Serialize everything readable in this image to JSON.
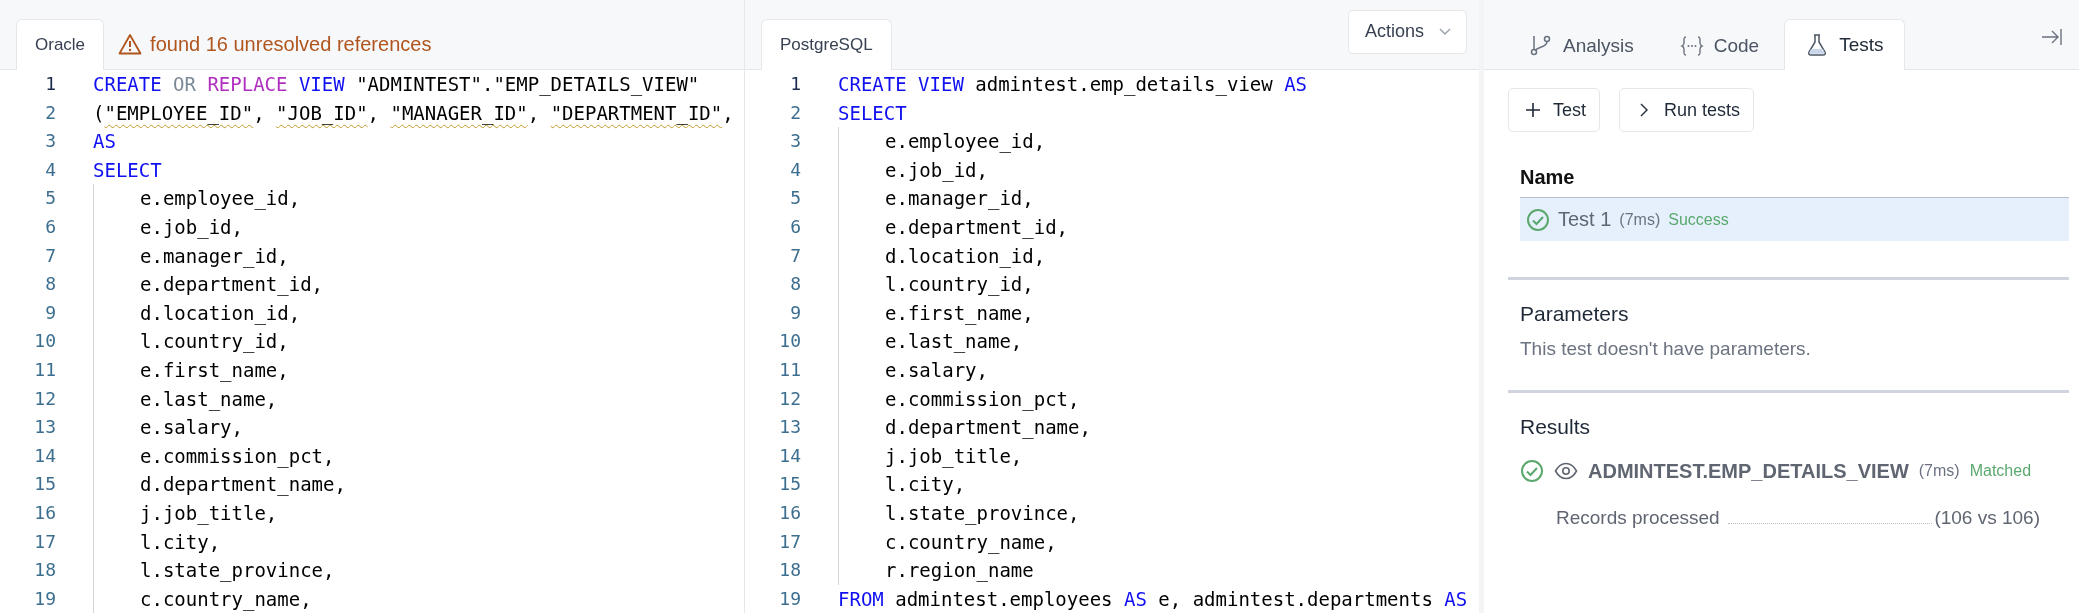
{
  "oracle_pane": {
    "tabs": [
      {
        "label": "Oracle",
        "selected": true
      }
    ],
    "warning": "found 16 unresolved references",
    "editor": {
      "lines": [
        {
          "n": "1",
          "active": true,
          "indent": false,
          "tokens": [
            {
              "text": "CREATE ",
              "kind": "keyword"
            },
            {
              "text": "OR ",
              "kind": "muted"
            },
            {
              "text": "REPLACE ",
              "kind": "special"
            },
            {
              "text": "VIEW ",
              "kind": "keyword"
            },
            {
              "text": "\"ADMINTEST\".\"EMP_DETAILS_VIEW\"",
              "kind": "plain"
            }
          ]
        },
        {
          "n": "2",
          "active": false,
          "indent": false,
          "tokens": [
            {
              "text": "(",
              "kind": "plain"
            },
            {
              "text": "\"EMPLOYEE_ID\"",
              "kind": "warn"
            },
            {
              "text": ", ",
              "kind": "plain"
            },
            {
              "text": "\"JOB_ID\"",
              "kind": "warn"
            },
            {
              "text": ", ",
              "kind": "plain"
            },
            {
              "text": "\"MANAGER_ID\"",
              "kind": "warn"
            },
            {
              "text": ", ",
              "kind": "plain"
            },
            {
              "text": "\"DEPARTMENT_ID\"",
              "kind": "warn"
            },
            {
              "text": ",",
              "kind": "plain"
            }
          ]
        },
        {
          "n": "3",
          "active": false,
          "indent": false,
          "tokens": [
            {
              "text": "AS",
              "kind": "keyword"
            }
          ]
        },
        {
          "n": "4",
          "active": false,
          "indent": false,
          "tokens": [
            {
              "text": "SELECT",
              "kind": "keyword"
            }
          ]
        },
        {
          "n": "5",
          "active": false,
          "indent": true,
          "tokens": [
            {
              "text": "e.employee_id,",
              "kind": "plain"
            }
          ]
        },
        {
          "n": "6",
          "active": false,
          "indent": true,
          "tokens": [
            {
              "text": "e.job_id,",
              "kind": "plain"
            }
          ]
        },
        {
          "n": "7",
          "active": false,
          "indent": true,
          "tokens": [
            {
              "text": "e.manager_id,",
              "kind": "plain"
            }
          ]
        },
        {
          "n": "8",
          "active": false,
          "indent": true,
          "tokens": [
            {
              "text": "e.department_id,",
              "kind": "plain"
            }
          ]
        },
        {
          "n": "9",
          "active": false,
          "indent": true,
          "tokens": [
            {
              "text": "d.location_id,",
              "kind": "plain"
            }
          ]
        },
        {
          "n": "10",
          "active": false,
          "indent": true,
          "tokens": [
            {
              "text": "l.country_id,",
              "kind": "plain"
            }
          ]
        },
        {
          "n": "11",
          "active": false,
          "indent": true,
          "tokens": [
            {
              "text": "e.first_name,",
              "kind": "plain"
            }
          ]
        },
        {
          "n": "12",
          "active": false,
          "indent": true,
          "tokens": [
            {
              "text": "e.last_name,",
              "kind": "plain"
            }
          ]
        },
        {
          "n": "13",
          "active": false,
          "indent": true,
          "tokens": [
            {
              "text": "e.salary,",
              "kind": "plain"
            }
          ]
        },
        {
          "n": "14",
          "active": false,
          "indent": true,
          "tokens": [
            {
              "text": "e.commission_pct,",
              "kind": "plain"
            }
          ]
        },
        {
          "n": "15",
          "active": false,
          "indent": true,
          "tokens": [
            {
              "text": "d.department_name,",
              "kind": "plain"
            }
          ]
        },
        {
          "n": "16",
          "active": false,
          "indent": true,
          "tokens": [
            {
              "text": "j.job_title,",
              "kind": "plain"
            }
          ]
        },
        {
          "n": "17",
          "active": false,
          "indent": true,
          "tokens": [
            {
              "text": "l.city,",
              "kind": "plain"
            }
          ]
        },
        {
          "n": "18",
          "active": false,
          "indent": true,
          "tokens": [
            {
              "text": "l.state_province,",
              "kind": "plain"
            }
          ]
        },
        {
          "n": "19",
          "active": false,
          "indent": true,
          "tokens": [
            {
              "text": "c.country_name,",
              "kind": "plain"
            }
          ]
        }
      ]
    }
  },
  "postgres_pane": {
    "tabs": [
      {
        "label": "PostgreSQL",
        "selected": true
      }
    ],
    "actions_button": "Actions",
    "editor": {
      "lines": [
        {
          "n": "1",
          "active": true,
          "indent": false,
          "tokens": [
            {
              "text": "CREATE VIEW ",
              "kind": "keyword"
            },
            {
              "text": "admintest.emp_details_view ",
              "kind": "plain"
            },
            {
              "text": "AS",
              "kind": "keyword"
            }
          ]
        },
        {
          "n": "2",
          "active": false,
          "indent": false,
          "tokens": [
            {
              "text": "SELECT",
              "kind": "keyword"
            }
          ]
        },
        {
          "n": "3",
          "active": false,
          "indent": true,
          "tokens": [
            {
              "text": "e.employee_id,",
              "kind": "plain"
            }
          ]
        },
        {
          "n": "4",
          "active": false,
          "indent": true,
          "tokens": [
            {
              "text": "e.job_id,",
              "kind": "plain"
            }
          ]
        },
        {
          "n": "5",
          "active": false,
          "indent": true,
          "tokens": [
            {
              "text": "e.manager_id,",
              "kind": "plain"
            }
          ]
        },
        {
          "n": "6",
          "active": false,
          "indent": true,
          "tokens": [
            {
              "text": "e.department_id,",
              "kind": "plain"
            }
          ]
        },
        {
          "n": "7",
          "active": false,
          "indent": true,
          "tokens": [
            {
              "text": "d.location_id,",
              "kind": "plain"
            }
          ]
        },
        {
          "n": "8",
          "active": false,
          "indent": true,
          "tokens": [
            {
              "text": "l.country_id,",
              "kind": "plain"
            }
          ]
        },
        {
          "n": "9",
          "active": false,
          "indent": true,
          "tokens": [
            {
              "text": "e.first_name,",
              "kind": "plain"
            }
          ]
        },
        {
          "n": "10",
          "active": false,
          "indent": true,
          "tokens": [
            {
              "text": "e.last_name,",
              "kind": "plain"
            }
          ]
        },
        {
          "n": "11",
          "active": false,
          "indent": true,
          "tokens": [
            {
              "text": "e.salary,",
              "kind": "plain"
            }
          ]
        },
        {
          "n": "12",
          "active": false,
          "indent": true,
          "tokens": [
            {
              "text": "e.commission_pct,",
              "kind": "plain"
            }
          ]
        },
        {
          "n": "13",
          "active": false,
          "indent": true,
          "tokens": [
            {
              "text": "d.department_name,",
              "kind": "plain"
            }
          ]
        },
        {
          "n": "14",
          "active": false,
          "indent": true,
          "tokens": [
            {
              "text": "j.job_title,",
              "kind": "plain"
            }
          ]
        },
        {
          "n": "15",
          "active": false,
          "indent": true,
          "tokens": [
            {
              "text": "l.city,",
              "kind": "plain"
            }
          ]
        },
        {
          "n": "16",
          "active": false,
          "indent": true,
          "tokens": [
            {
              "text": "l.state_province,",
              "kind": "plain"
            }
          ]
        },
        {
          "n": "17",
          "active": false,
          "indent": true,
          "tokens": [
            {
              "text": "c.country_name,",
              "kind": "plain"
            }
          ]
        },
        {
          "n": "18",
          "active": false,
          "indent": true,
          "tokens": [
            {
              "text": "r.region_name",
              "kind": "plain"
            }
          ]
        },
        {
          "n": "19",
          "active": false,
          "indent": false,
          "tokens": [
            {
              "text": "FROM ",
              "kind": "keyword"
            },
            {
              "text": "admintest.employees ",
              "kind": "plain"
            },
            {
              "text": "AS ",
              "kind": "keyword"
            },
            {
              "text": "e, admintest.departments ",
              "kind": "plain"
            },
            {
              "text": "AS",
              "kind": "keyword"
            }
          ]
        }
      ]
    }
  },
  "side_panel": {
    "tabs": [
      {
        "label": "Analysis",
        "selected": false
      },
      {
        "label": "Code",
        "selected": false
      },
      {
        "label": "Tests",
        "selected": true
      }
    ],
    "buttons": [
      "Test",
      "Run tests"
    ],
    "tests_table": {
      "columns": [
        "Name"
      ],
      "rows": [
        {
          "name": "Test 1",
          "duration": "(7ms)",
          "status": "Success",
          "passed": true,
          "selected": true
        }
      ]
    },
    "parameters": {
      "title": "Parameters",
      "message": "This test doesn't have parameters."
    },
    "results": {
      "title": "Results",
      "items": [
        {
          "name": "ADMINTEST.EMP_DETAILS_VIEW",
          "duration": "(7ms)",
          "status": "Matched",
          "passed": true,
          "metrics": [
            {
              "label": "Records processed",
              "value": "(106 vs 106)"
            }
          ]
        }
      ]
    }
  }
}
